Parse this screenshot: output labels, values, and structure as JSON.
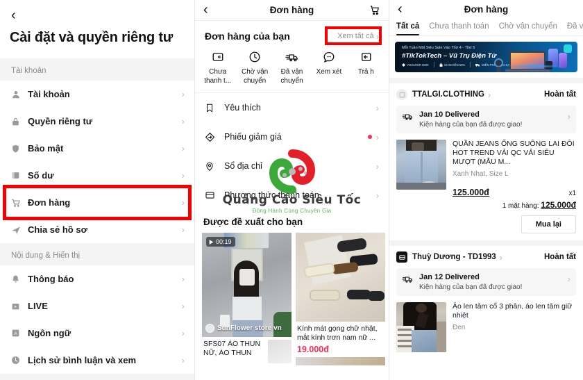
{
  "settings": {
    "back_icon": "chevron-left-icon",
    "title": "Cài đặt và quyền riêng tư",
    "sections": [
      {
        "label": "Tài khoản",
        "items": [
          {
            "icon": "person-icon",
            "label": "Tài khoản",
            "highlight": false
          },
          {
            "icon": "lock-icon",
            "label": "Quyền riêng tư",
            "highlight": false
          },
          {
            "icon": "shield-icon",
            "label": "Bảo mật",
            "highlight": false
          },
          {
            "icon": "wallet-icon",
            "label": "Số dư",
            "highlight": false
          },
          {
            "icon": "cart-icon",
            "label": "Đơn hàng",
            "highlight": true
          },
          {
            "icon": "share-icon",
            "label": "Chia sẻ hồ sơ",
            "highlight": false
          }
        ]
      },
      {
        "label": "Nội dung & Hiển thị",
        "items": [
          {
            "icon": "bell-icon",
            "label": "Thông báo",
            "highlight": false
          },
          {
            "icon": "live-icon",
            "label": "LIVE",
            "highlight": false
          },
          {
            "icon": "language-icon",
            "label": "Ngôn ngữ",
            "highlight": false
          },
          {
            "icon": "clock-icon",
            "label": "Lịch sử bình luận và xem",
            "highlight": false
          }
        ]
      }
    ]
  },
  "orders_home": {
    "navbar": {
      "back_icon": "chevron-left-icon",
      "title": "Đơn hàng",
      "cart_icon": "cart-icon"
    },
    "section_title": "Đơn hàng của bạn",
    "view_all": "Xem tất cả",
    "view_all_chevron": "›",
    "statuses": [
      {
        "icon": "wallet-card-icon",
        "line1": "Chưa",
        "line2": "thanh t..."
      },
      {
        "icon": "clock-icon",
        "line1": "Chờ vận",
        "line2": "chuyển"
      },
      {
        "icon": "truck-icon",
        "line1": "Đã vận",
        "line2": "chuyển"
      },
      {
        "icon": "comment-icon",
        "line1": "Xem xét",
        "line2": ""
      },
      {
        "icon": "return-box-icon",
        "line1": "Trả h",
        "line2": ""
      }
    ],
    "menu": [
      {
        "icon": "bookmark-icon",
        "label": "Yêu thích",
        "dot": false
      },
      {
        "icon": "coupon-icon",
        "label": "Phiếu giảm giá",
        "dot": true
      },
      {
        "icon": "location-icon",
        "label": "Sổ địa chỉ",
        "dot": false
      },
      {
        "icon": "creditcard-icon",
        "label": "Phương thức thanh toán",
        "dot": false
      }
    ],
    "reco_title": "Được đề xuất cho bạn",
    "reco_cards": [
      {
        "duration": "00:19",
        "shop": "SunFlower store vn",
        "title": "SFS07 ÁO THUN NỮ, ÁO THUN",
        "price": "",
        "has_video": true
      },
      {
        "duration": "",
        "shop": "",
        "title": "Kính mát gọng chữ nhật, mắt kính trơn nam nữ ...",
        "price": "19.000đ",
        "has_video": false
      }
    ],
    "watermark": {
      "line1": "Quảng Cáo Siêu Tốc",
      "line2": "Đồng Hành Cùng Chuyên Gia"
    }
  },
  "order_list": {
    "navbar": {
      "back_icon": "chevron-left-icon",
      "title": "Đơn hàng"
    },
    "tabs": [
      {
        "label": "Tất cả",
        "active": true
      },
      {
        "label": "Chưa thanh toán",
        "active": false
      },
      {
        "label": "Chờ vận chuyển",
        "active": false
      },
      {
        "label": "Đã v",
        "active": false
      }
    ],
    "banner": {
      "line1": "Mỗi Tuần Một Siêu Sale Vào Thứ 4 - Thứ 5",
      "line2": "#TikTokTech – Vũ Trụ Điện Tử",
      "pills": [
        "VOUCHER 500K",
        "GIẢM ĐẾN 50%",
        "MIỄN PHÍ VẬN CHUYỂN"
      ]
    },
    "orders": [
      {
        "shop_icon": "store-icon",
        "shop": "TTALGI.CLOTHING",
        "shop_chevron": "›",
        "status": "Hoàn tất",
        "ship_icon": "truck-icon",
        "ship_title": "Jan 10 Delivered",
        "ship_sub": "Kiện hàng của bạn đã được giao!",
        "ship_chevron": "›",
        "product_title": "QUẦN JEANS ỐNG SUÔNG LAI ĐÔI HOT TREND VẢI QC VẢI SIÊU MƯỢT (MẪU M...",
        "variant": "Xanh Nhạt, Size L",
        "price": "125.000đ",
        "qty": "x1",
        "total_label": "1 mặt hàng:",
        "total_value": "125.000đ",
        "action": "Mua lại"
      },
      {
        "shop_icon": "store-icon",
        "shop": "Thuỳ Dương - TD1993",
        "shop_chevron": "›",
        "status": "Hoàn tất",
        "ship_icon": "truck-icon",
        "ship_title": "Jan 12 Delivered",
        "ship_sub": "Kiện hàng của bạn đã được giao!",
        "ship_chevron": "›",
        "product_title": "Áo len tăm cổ 3 phân, áo len tăm giữ nhiệt",
        "variant": "Đen",
        "price": "",
        "qty": "",
        "total_label": "",
        "total_value": "",
        "action": ""
      }
    ]
  },
  "colors": {
    "highlight_red": "#f30000",
    "accent_pink": "#fe2c55",
    "text_primary": "#121212",
    "text_muted": "#8a8a8e",
    "panel_bg": "#f4f4f4"
  }
}
